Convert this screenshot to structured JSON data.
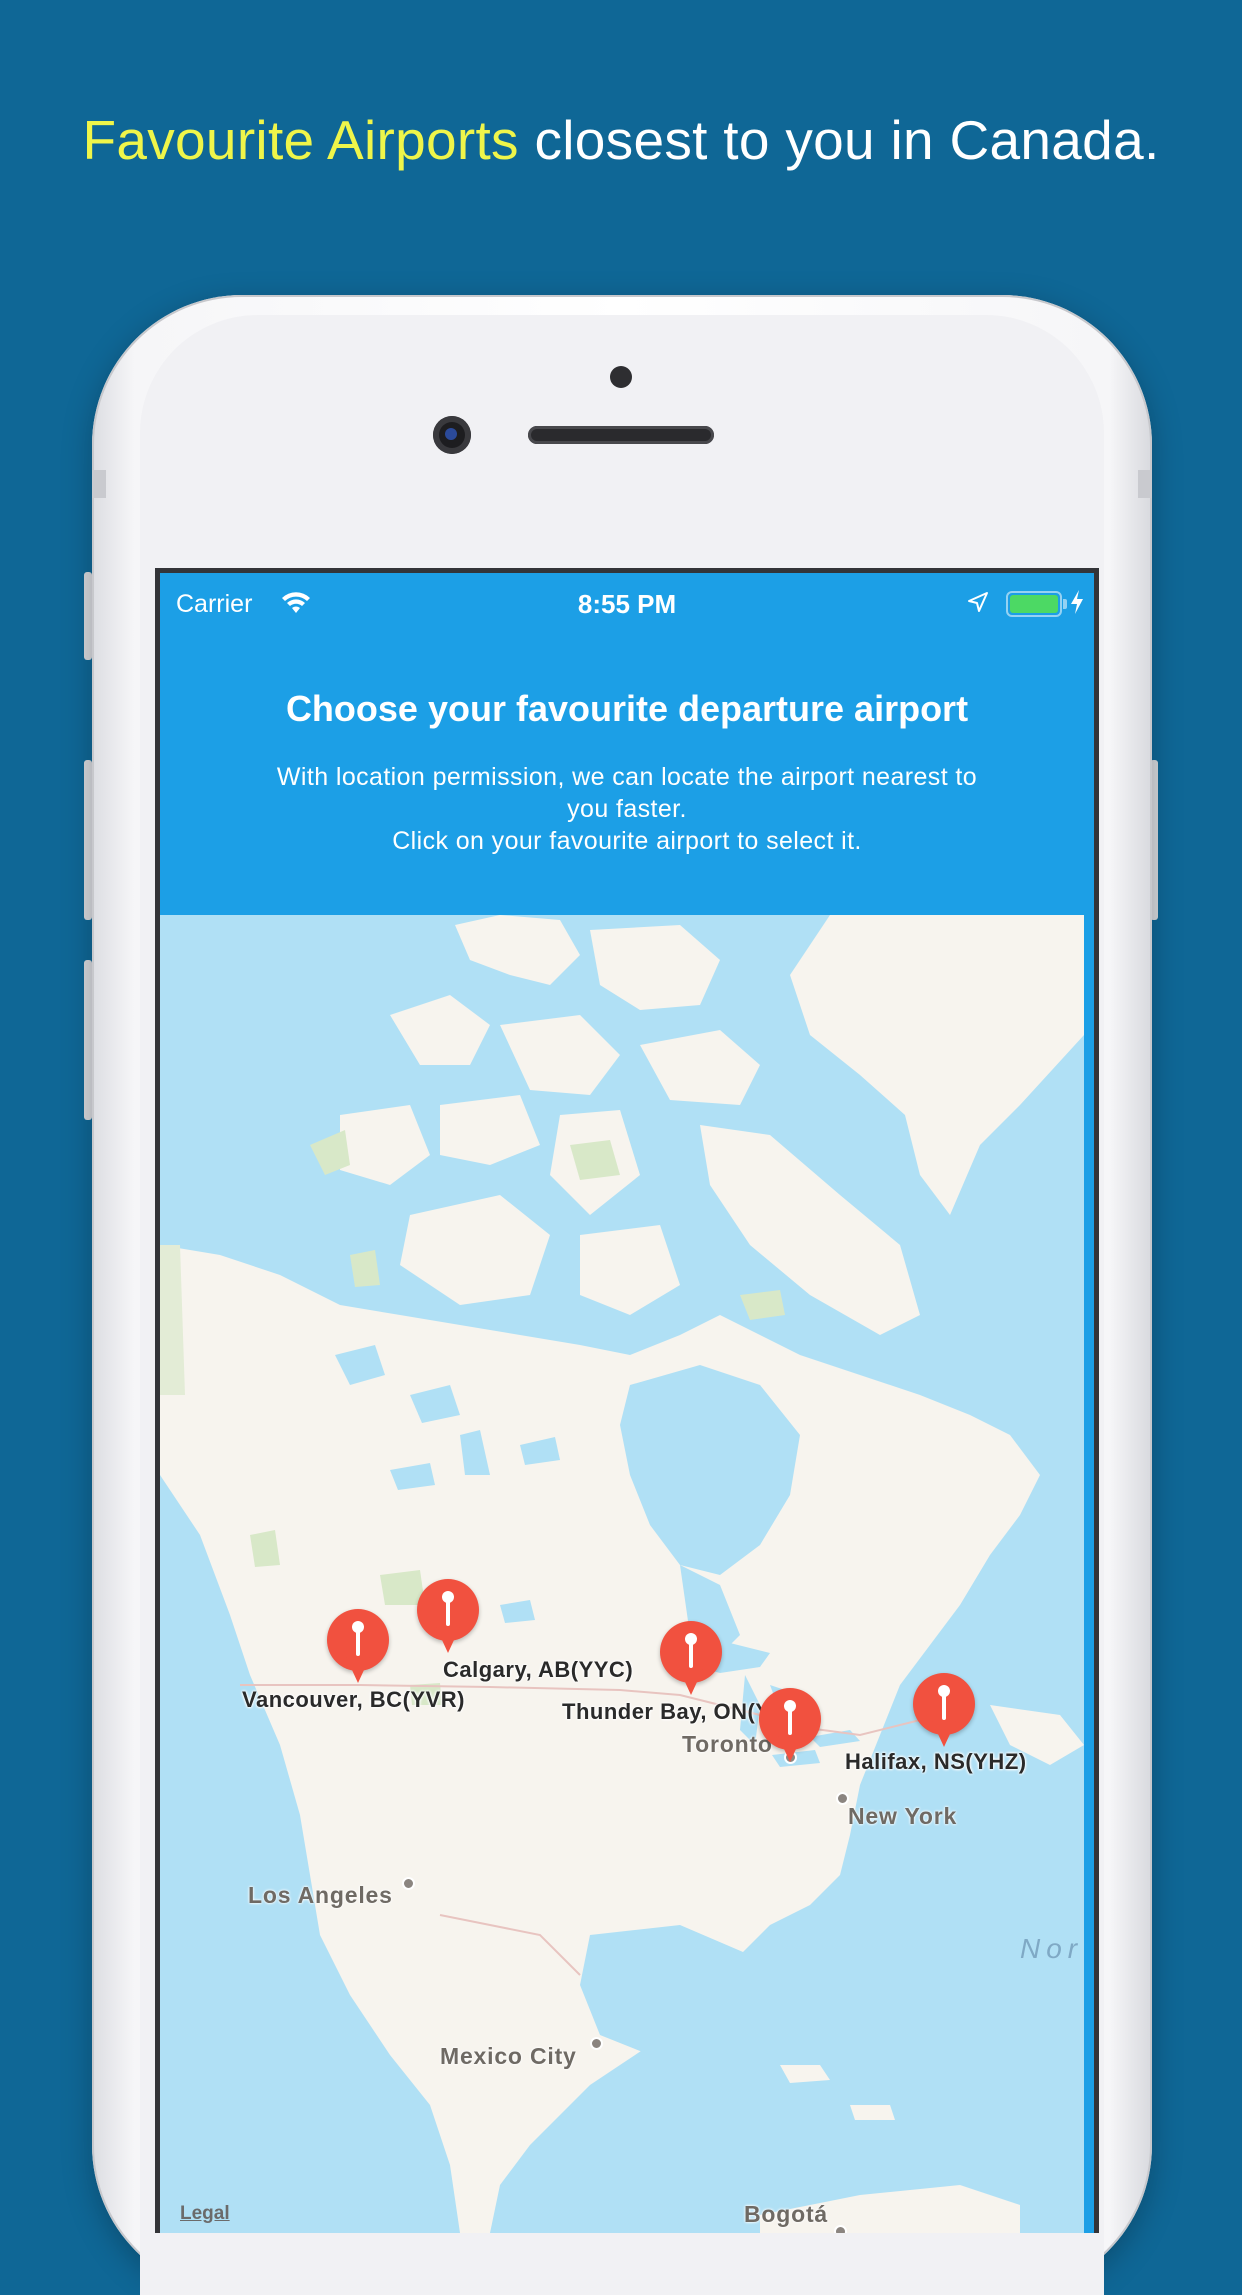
{
  "headline": {
    "highlight": "Favourite Airports",
    "rest": " closest to you in Canada."
  },
  "status_bar": {
    "carrier": "Carrier",
    "time": "8:55 PM",
    "battery_level": 1.0
  },
  "panel": {
    "title": "Choose your favourite departure airport",
    "description_line1": "With location permission, we can locate the airport nearest to",
    "description_line2": "you faster.",
    "description_line3": "Click on your favourite airport to select it."
  },
  "map": {
    "airports": [
      {
        "label": "Vancouver, BC(YVR)"
      },
      {
        "label": "Calgary, AB(YYC)"
      },
      {
        "label": "Thunder Bay, ON(YQT)"
      },
      {
        "label": "Halifax, NS(YHZ)"
      }
    ],
    "cities": [
      "Toronto",
      "New York",
      "Los Angeles",
      "Mexico City",
      "Bogotá"
    ],
    "ocean_label": "Nor",
    "legal": "Legal"
  }
}
